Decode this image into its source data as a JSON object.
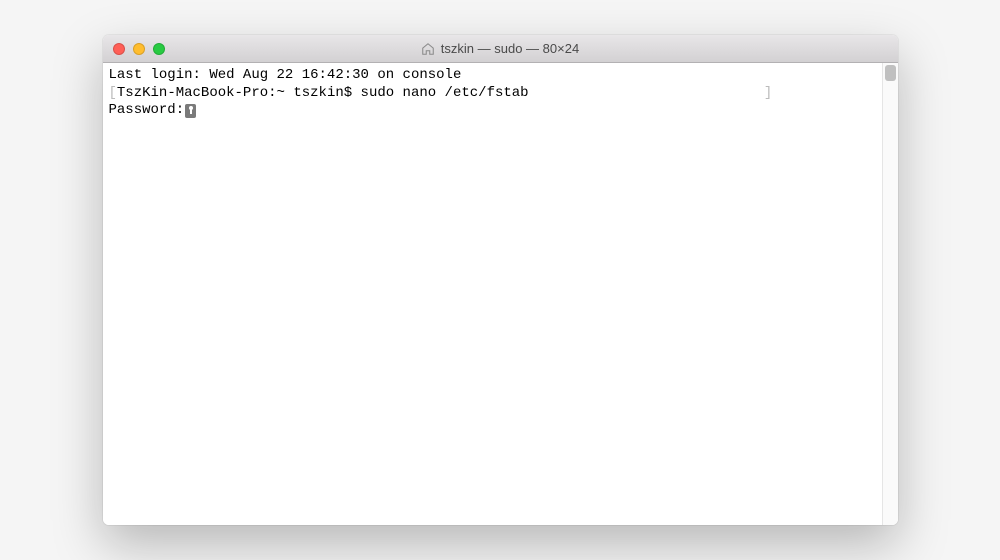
{
  "window": {
    "title": "tszkin — sudo — 80×24"
  },
  "terminal": {
    "last_login": "Last login: Wed Aug 22 16:42:30 on console",
    "prompt_host": "TszKin-MacBook-Pro:~ tszkin$ ",
    "command": "sudo nano /etc/fstab",
    "password_label": "Password:"
  }
}
